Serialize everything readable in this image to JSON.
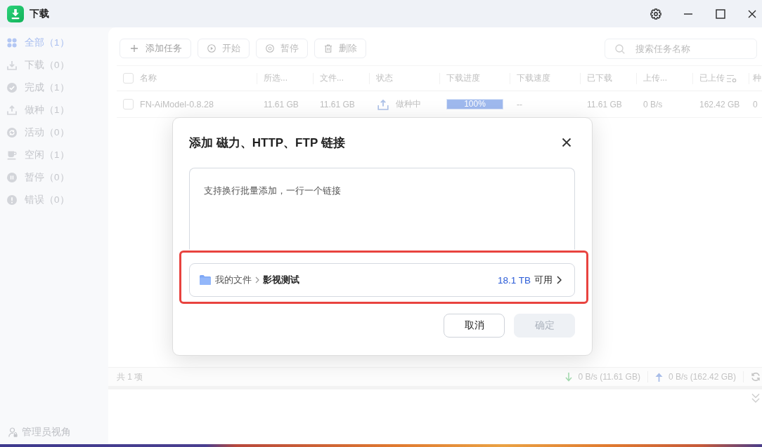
{
  "window": {
    "title": "下载"
  },
  "sidebar": {
    "items": [
      {
        "label": "全部（1）",
        "selected": true
      },
      {
        "label": "下载（0）",
        "selected": false
      },
      {
        "label": "完成（1）",
        "selected": false
      },
      {
        "label": "做种（1）",
        "selected": false
      },
      {
        "label": "活动（0）",
        "selected": false
      },
      {
        "label": "空闲（1）",
        "selected": false
      },
      {
        "label": "暂停（0）",
        "selected": false
      },
      {
        "label": "错误（0）",
        "selected": false
      }
    ],
    "footer": "管理员视角"
  },
  "toolbar": {
    "buttons": [
      {
        "label": "添加任务",
        "disabled": false
      },
      {
        "label": "开始",
        "disabled": true
      },
      {
        "label": "暂停",
        "disabled": true
      },
      {
        "label": "删除",
        "disabled": true
      }
    ],
    "search": {
      "placeholder": "搜索任务名称"
    }
  },
  "table": {
    "select_all_checked": false,
    "columns": [
      "名称",
      "所选...",
      "文件...",
      "状态",
      "下载进度",
      "下载速度",
      "已下载",
      "上传...",
      "已上传",
      "种"
    ],
    "rows": [
      {
        "checked": false,
        "name": "FN-AiModel-0.8.28",
        "selected_size": "11.61 GB",
        "file_size": "11.61 GB",
        "status": "做种中",
        "progress": {
          "level": 1,
          "reading": "100%"
        },
        "download_speed": "--",
        "downloaded": "11.61 GB",
        "upload_speed": "0 B/s",
        "uploaded": "162.42 GB",
        "column_10": "0"
      }
    ]
  },
  "status_bar": {
    "count": "共 1 项",
    "download": "0 B/s (11.61 GB)",
    "upload": "0 B/s (162.42 GB)"
  },
  "dialog": {
    "title": "添加 磁力、HTTP、FTP 链接",
    "links_field": {
      "placeholder": "支持换行批量添加，一行一个链接"
    },
    "folder": {
      "highlighted": true,
      "path": [
        "我的文件",
        "影视测试"
      ],
      "free_space": "18.1 TB",
      "free_label": "可用"
    },
    "buttons": [
      {
        "label": "取消",
        "kind": "secondary",
        "disabled": false
      },
      {
        "label": "确定",
        "kind": "primary",
        "disabled": true
      }
    ]
  }
}
